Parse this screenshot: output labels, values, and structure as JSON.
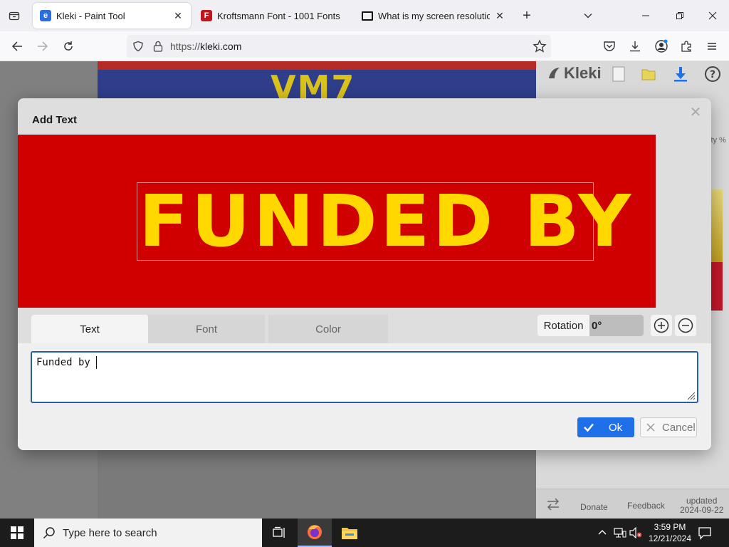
{
  "browser": {
    "tabs": [
      {
        "title": "Kleki - Paint Tool",
        "active": true,
        "favicon_color": "#2a6fe0"
      },
      {
        "title": "Kroftsmann Font - 1001 Fonts",
        "active": false,
        "favicon_color": "#c0161c"
      },
      {
        "title": "What is my screen resolution -",
        "active": false,
        "favicon_color": "#111111"
      }
    ],
    "url_prefix": "https://",
    "url_domain": "kleki.com"
  },
  "page": {
    "kleki_logo": "Kleki",
    "canvas_glimpse_text": "VM7",
    "side_text": "ity %",
    "bottom": {
      "donate": "Donate",
      "feedback": "Feedback",
      "updated_label": "updated",
      "updated_date": "2024-09-22"
    }
  },
  "dialog": {
    "title": "Add Text",
    "preview_text": "FUNDED BY",
    "tabs": {
      "text": "Text",
      "font": "Font",
      "color": "Color"
    },
    "rotation_label": "Rotation",
    "rotation_value": "0°",
    "text_value": "Funded by ",
    "ok_label": "Ok",
    "cancel_label": "Cancel",
    "colors": {
      "preview_bg": "#d10000",
      "preview_text": "#ffd800",
      "ok_bg": "#1e6fe8"
    }
  },
  "taskbar": {
    "search_placeholder": "Type here to search",
    "time": "3:59 PM",
    "date": "12/21/2024"
  }
}
